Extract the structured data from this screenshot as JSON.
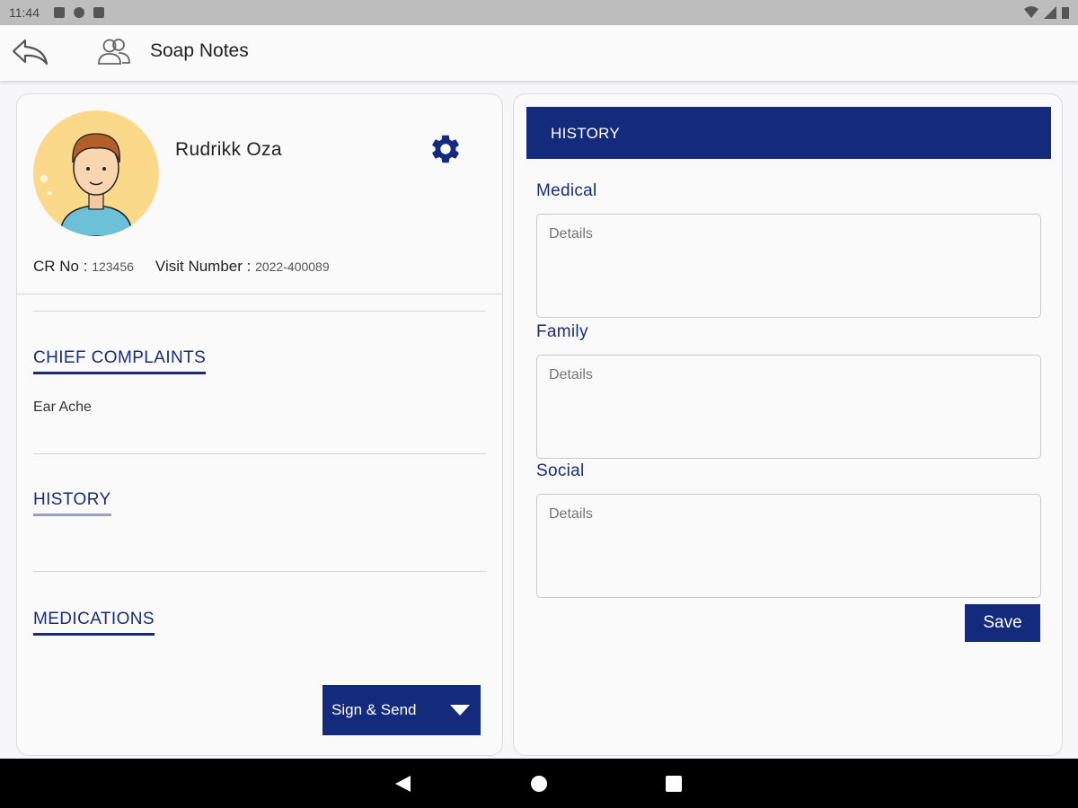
{
  "status_bar": {
    "time": "11:44"
  },
  "app_bar": {
    "title": "Soap Notes"
  },
  "patient": {
    "name": "Rudrikk Oza",
    "cr_label": "CR No : ",
    "cr_value": "123456",
    "visit_label": "Visit Number : ",
    "visit_value": "2022-400089"
  },
  "sections": {
    "chief_complaints": "CHIEF COMPLAINTS",
    "complaint_text": "Ear Ache",
    "history": "HISTORY",
    "medications": "MEDICATIONS"
  },
  "sign_send_label": "Sign & Send",
  "history_panel": {
    "header": "HISTORY",
    "fields": [
      {
        "label": "Medical",
        "placeholder": "Details"
      },
      {
        "label": "Family",
        "placeholder": "Details"
      },
      {
        "label": "Social",
        "placeholder": "Details"
      }
    ],
    "save_label": "Save"
  },
  "colors": {
    "primary": "#142a7c",
    "avatar_bg": "#fbd98b"
  },
  "icons": [
    "back-arrow-icon",
    "users-icon",
    "gear-icon",
    "chevron-down-icon"
  ]
}
